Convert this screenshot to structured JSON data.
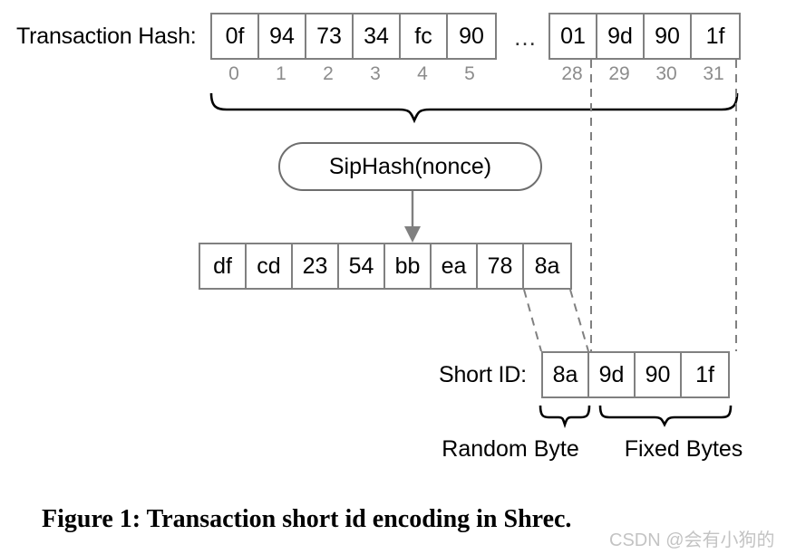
{
  "figure": {
    "caption": "Figure 1: Transaction short id encoding in Shrec.",
    "watermark": "CSDN @会有小狗的"
  },
  "transaction_hash": {
    "label": "Transaction Hash:",
    "ellipsis": "…",
    "left_group": {
      "bytes": [
        "0f",
        "94",
        "73",
        "34",
        "fc",
        "90"
      ],
      "indices": [
        "0",
        "1",
        "2",
        "3",
        "4",
        "5"
      ]
    },
    "right_group": {
      "bytes": [
        "01",
        "9d",
        "90",
        "1f"
      ],
      "indices": [
        "28",
        "29",
        "30",
        "31"
      ]
    }
  },
  "hash_function": {
    "label": "SipHash(nonce)"
  },
  "hash_output": {
    "bytes": [
      "df",
      "cd",
      "23",
      "54",
      "bb",
      "ea",
      "78",
      "8a"
    ]
  },
  "short_id": {
    "label": "Short ID:",
    "bytes": [
      "8a",
      "9d",
      "90",
      "1f"
    ]
  },
  "annotations": {
    "random_byte": "Random Byte",
    "fixed_bytes": "Fixed Bytes"
  },
  "colors": {
    "cell_border": "#808080",
    "index_text": "#8c8c8c",
    "stadium_border": "#6e6e6e",
    "dashed_line": "#808080",
    "brace": "#000000",
    "arrow": "#808080"
  }
}
